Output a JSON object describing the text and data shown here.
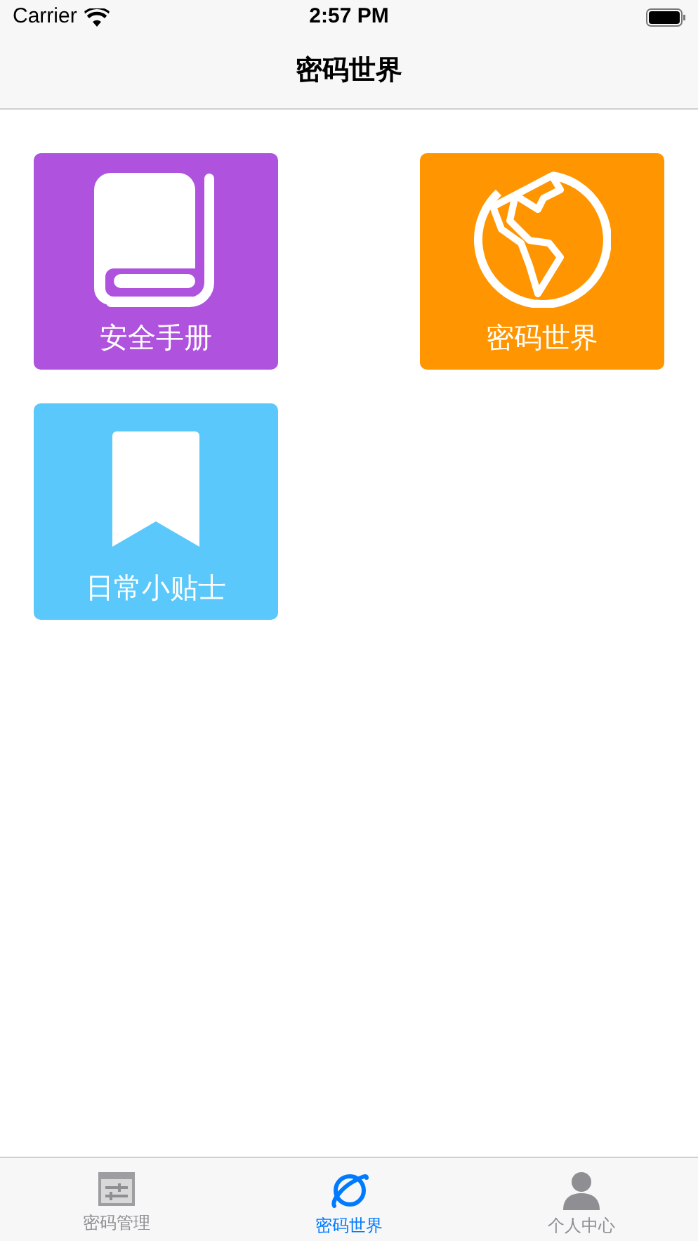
{
  "status_bar": {
    "carrier": "Carrier",
    "time": "2:57 PM"
  },
  "nav_bar": {
    "title": "密码世界"
  },
  "tiles": [
    {
      "kind": "book",
      "label": "安全手册",
      "color": "#af52de"
    },
    {
      "kind": "globe",
      "label": "密码世界",
      "color": "#ff9500"
    },
    {
      "kind": "bookmark",
      "label": "日常小贴士",
      "color": "#5ac8fa"
    }
  ],
  "tab_bar": [
    {
      "kind": "sliders",
      "label": "密码管理",
      "selected": false
    },
    {
      "kind": "planet",
      "label": "密码世界",
      "selected": true
    },
    {
      "kind": "person",
      "label": "个人中心",
      "selected": false
    }
  ]
}
